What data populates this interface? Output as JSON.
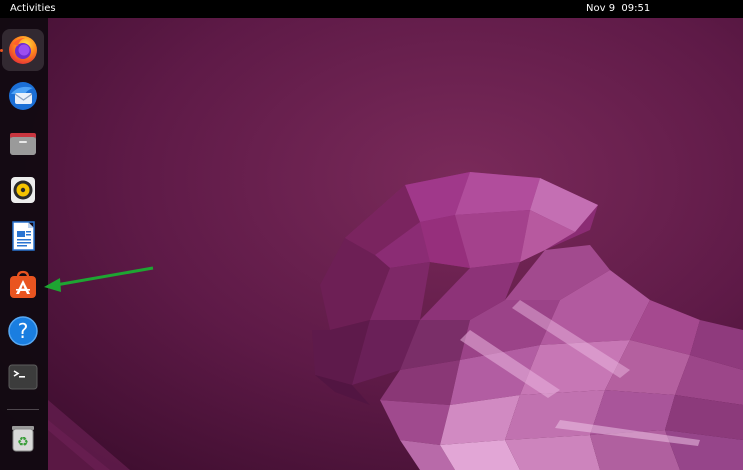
{
  "top_bar": {
    "activities_label": "Activities",
    "clock_date": "Nov 9",
    "clock_time": "09:51"
  },
  "dock": {
    "items": [
      {
        "app": "Firefox",
        "icon": "firefox-icon",
        "active": true
      },
      {
        "app": "Thunderbird",
        "icon": "thunderbird-icon",
        "active": false
      },
      {
        "app": "Files",
        "icon": "files-icon",
        "active": false
      },
      {
        "app": "Rhythmbox",
        "icon": "rhythmbox-icon",
        "active": false
      },
      {
        "app": "LibreOffice Writer",
        "icon": "libreoffice-writer-icon",
        "active": false
      },
      {
        "app": "Ubuntu Software",
        "icon": "ubuntu-software-icon",
        "active": false
      },
      {
        "app": "Help",
        "icon": "help-icon",
        "active": false
      },
      {
        "app": "Terminal",
        "icon": "terminal-icon",
        "active": false
      },
      {
        "app": "Trash",
        "icon": "trash-icon",
        "active": false
      }
    ]
  },
  "annotation": {
    "arrow_color": "#1ea532",
    "points_to": "Ubuntu Software"
  },
  "colors": {
    "accent": "#e95420",
    "wallpaper_base": "#6b1f4f",
    "panel": "#000000"
  }
}
